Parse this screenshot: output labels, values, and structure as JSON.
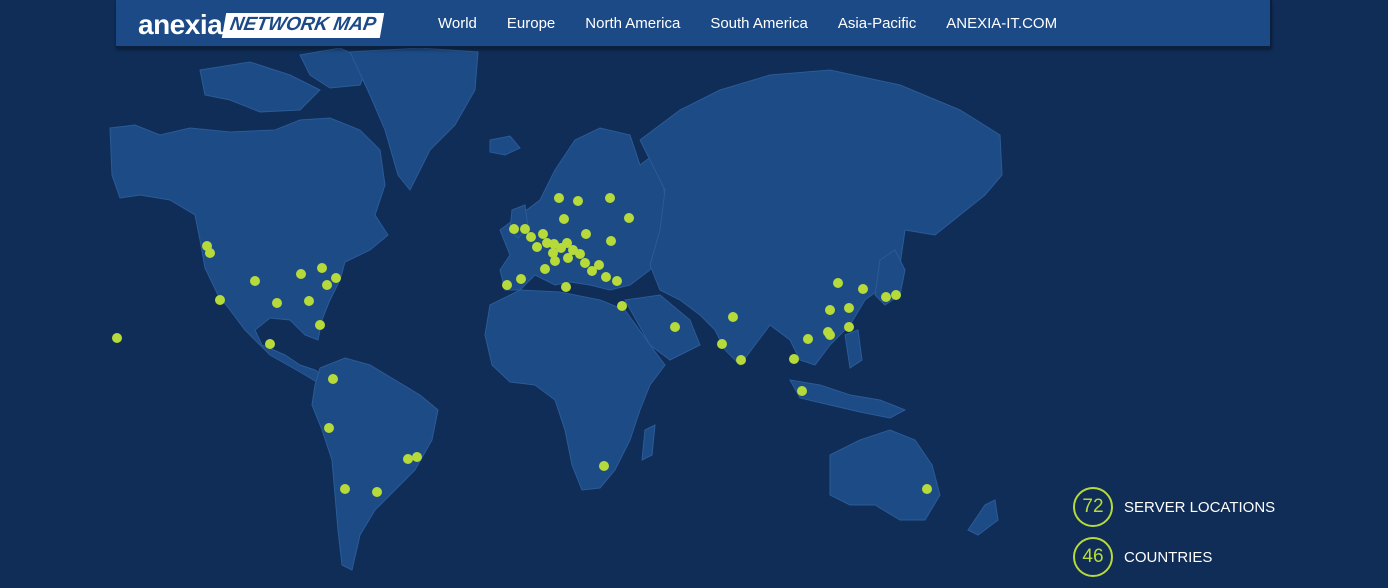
{
  "brand": {
    "name": "anexia",
    "product": "NETWORK MAP"
  },
  "nav": [
    {
      "label": "World"
    },
    {
      "label": "Europe"
    },
    {
      "label": "North America"
    },
    {
      "label": "South America"
    },
    {
      "label": "Asia-Pacific"
    },
    {
      "label": "ANEXIA-IT.COM"
    }
  ],
  "stats": {
    "locations": {
      "value": "72",
      "label": "SERVER LOCATIONS"
    },
    "countries": {
      "value": "46",
      "label": "COUNTRIES"
    }
  },
  "colors": {
    "background": "#0f2d56",
    "land": "#1c4b86",
    "header": "#1c4a87",
    "marker": "#b7da3b"
  },
  "icons": {
    "marker": "location-dot-icon"
  }
}
